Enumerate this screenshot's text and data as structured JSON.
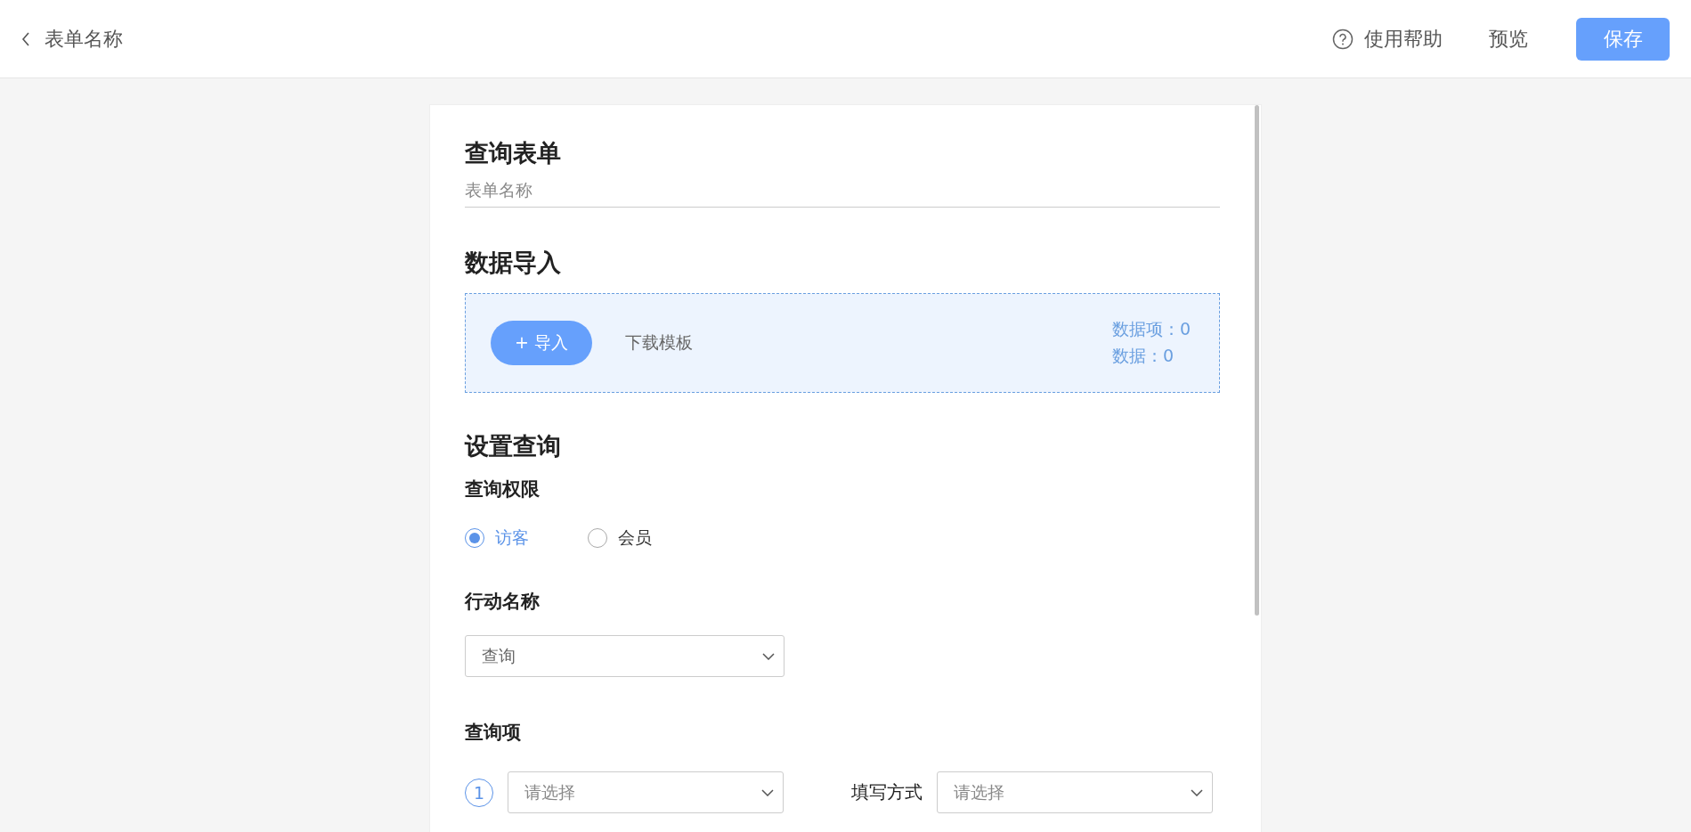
{
  "header": {
    "back_label": "表单名称",
    "help_label": "使用帮助",
    "preview_label": "预览",
    "save_label": "保存"
  },
  "form": {
    "title": "查询表单",
    "name_placeholder": "表单名称"
  },
  "data_import": {
    "title": "数据导入",
    "import_button": "+ 导入",
    "download_link": "下载模板",
    "stats": [
      "数据项：0",
      "数据：0"
    ]
  },
  "query_settings": {
    "title": "设置查询",
    "permission_label": "查询权限",
    "permission_options": [
      {
        "label": "访客",
        "selected": true
      },
      {
        "label": "会员",
        "selected": false
      }
    ],
    "action_label": "行动名称",
    "action_value": "查询",
    "items_label": "查询项",
    "items": [
      {
        "index": "1",
        "field_placeholder": "请选择",
        "mode_label": "填写方式",
        "mode_placeholder": "请选择"
      }
    ]
  }
}
